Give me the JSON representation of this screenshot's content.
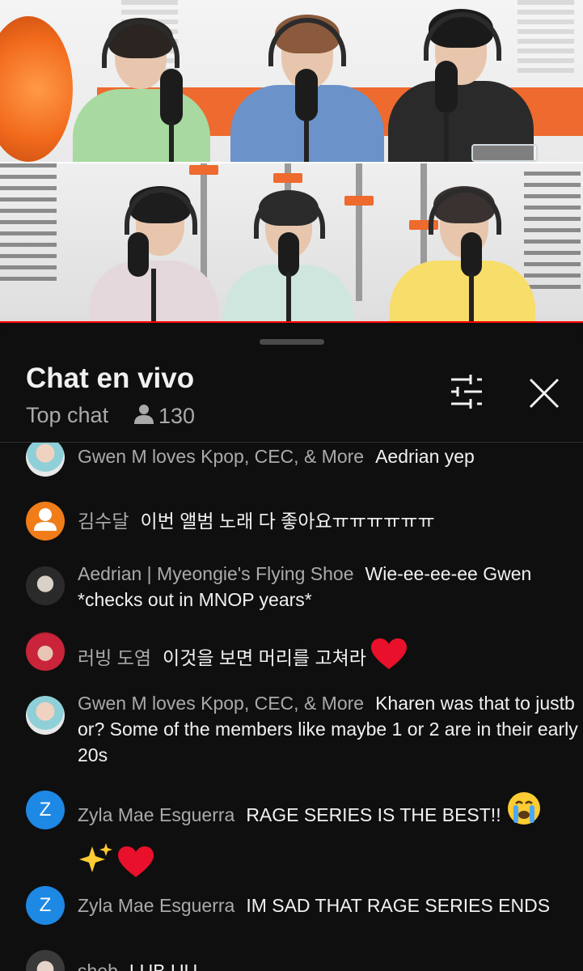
{
  "chat": {
    "title": "Chat en vivo",
    "mode": "Top chat",
    "viewers": "130"
  },
  "icons": {
    "viewer": "person-icon",
    "filter": "sliders-icon",
    "close": "close-icon",
    "default_avatar": "default-avatar-icon"
  },
  "colors": {
    "background": "#0f0f0f",
    "author": "#aaaaaa",
    "text": "#f1f1f1",
    "progress": "#ff0000",
    "letter_avatar": "#1e88e5",
    "default_avatar": "#f07d19"
  },
  "messages": [
    {
      "author": "Gwen M loves Kpop, CEC, & More",
      "text": "Aedrian yep"
    },
    {
      "author": "김수달",
      "text": "이번 앨범 노래 다 좋아요ㅠㅠㅠㅠㅠㅠ"
    },
    {
      "author": "Aedrian | Myeongie's Flying Shoe",
      "text": "Wie-ee-ee-ee Gwen *checks out in MNOP years*"
    },
    {
      "author": "러빙 도염",
      "text": "이것을 보면 머리를 고쳐라"
    },
    {
      "author": "Gwen M loves Kpop, CEC, & More",
      "text": "Kharen was that to justb or? Some of the members like maybe 1 or 2 are in their early 20s"
    },
    {
      "author": "Zyla Mae Esguerra",
      "text": "RAGE SERIES IS THE BEST!!",
      "avatar_letter": "Z"
    },
    {
      "author": "Zyla Mae Esguerra",
      "text": "IM SAD THAT RAGE SERIES ENDS",
      "avatar_letter": "Z"
    },
    {
      "author": "sheb",
      "text": "LUB UU"
    }
  ]
}
